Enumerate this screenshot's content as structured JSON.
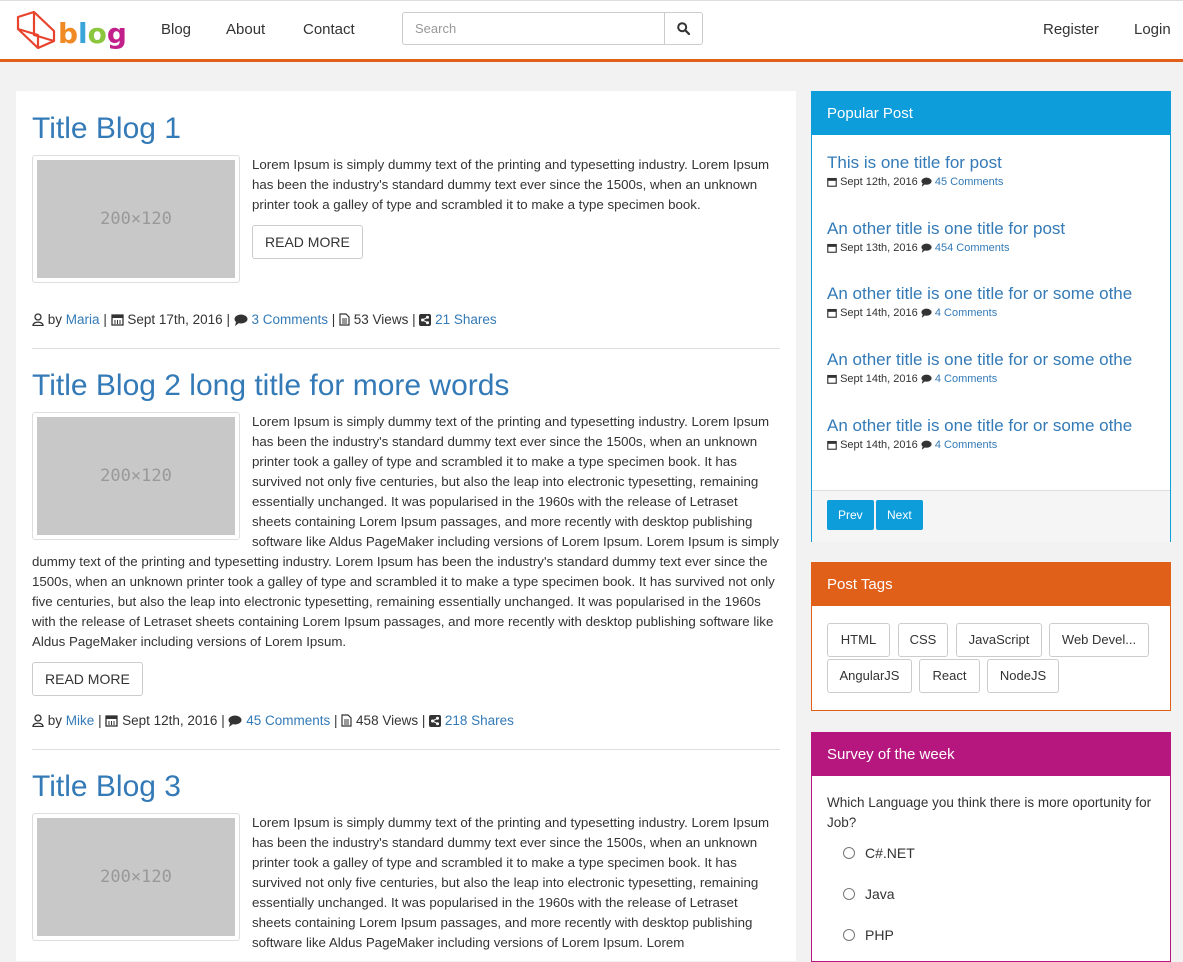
{
  "brand": {
    "logo_text": "blog",
    "colors": {
      "accent": "#e0601a",
      "link": "#337ab7",
      "popular": "#0d9ddb",
      "tags": "#e0601a",
      "survey": "#b5177f"
    }
  },
  "nav": {
    "links": [
      "Blog",
      "About",
      "Contact"
    ],
    "search_placeholder": "Search",
    "register": "Register",
    "login": "Login"
  },
  "posts": [
    {
      "title": "Title Blog 1",
      "thumb_label": "200×120",
      "body": "Lorem Ipsum is simply dummy text of the printing and typesetting industry. Lorem Ipsum has been the industry's standard dummy text ever since the 1500s, when an unknown printer took a galley of type and scrambled it to make a type specimen book.",
      "read_more": "READ MORE",
      "by": "by",
      "author": "Maria",
      "date": "Sept 17th, 2016",
      "comments": "3 Comments",
      "views": "53 Views",
      "shares": "21 Shares"
    },
    {
      "title": "Title Blog 2 long title for more words",
      "thumb_label": "200×120",
      "body": "Lorem Ipsum is simply dummy text of the printing and typesetting industry. Lorem Ipsum has been the industry's standard dummy text ever since the 1500s, when an unknown printer took a galley of type and scrambled it to make a type specimen book. It has survived not only five centuries, but also the leap into electronic typesetting, remaining essentially unchanged. It was popularised in the 1960s with the release of Letraset sheets containing Lorem Ipsum passages, and more recently with desktop publishing software like Aldus PageMaker including versions of Lorem Ipsum. Lorem Ipsum is simply dummy text of the printing and typesetting industry. Lorem Ipsum has been the industry's standard dummy text ever since the 1500s, when an unknown printer took a galley of type and scrambled it to make a type specimen book. It has survived not only five centuries, but also the leap into electronic typesetting, remaining essentially unchanged. It was popularised in the 1960s with the release of Letraset sheets containing Lorem Ipsum passages, and more recently with desktop publishing software like Aldus PageMaker including versions of Lorem Ipsum.",
      "read_more": "READ MORE",
      "by": "by",
      "author": "Mike",
      "date": "Sept 12th, 2016",
      "comments": "45 Comments",
      "views": "458 Views",
      "shares": "218 Shares"
    },
    {
      "title": "Title Blog 3",
      "thumb_label": "200×120",
      "body": "Lorem Ipsum is simply dummy text of the printing and typesetting industry. Lorem Ipsum has been the industry's standard dummy text ever since the 1500s, when an unknown printer took a galley of type and scrambled it to make a type specimen book. It has survived not only five centuries, but also the leap into electronic typesetting, remaining essentially unchanged. It was popularised in the 1960s with the release of Letraset sheets containing Lorem Ipsum passages, and more recently with desktop publishing software like Aldus PageMaker including versions of Lorem Ipsum. Lorem"
    }
  ],
  "popular": {
    "heading": "Popular Post",
    "items": [
      {
        "title": "This is one title for post",
        "date": "Sept 12th, 2016",
        "comments": "45 Comments"
      },
      {
        "title": "An other title is one title for post",
        "date": "Sept 13th, 2016",
        "comments": "454 Comments"
      },
      {
        "title": "An other title is one title for or some othe",
        "date": "Sept 14th, 2016",
        "comments": "4 Comments"
      },
      {
        "title": "An other title is one title for or some othe",
        "date": "Sept 14th, 2016",
        "comments": "4 Comments"
      },
      {
        "title": "An other title is one title for or some othe",
        "date": "Sept 14th, 2016",
        "comments": "4 Comments"
      }
    ],
    "prev": "Prev",
    "next": "Next"
  },
  "tags": {
    "heading": "Post Tags",
    "items": [
      "HTML",
      "CSS",
      "JavaScript",
      "Web Devel...",
      "AngularJS",
      "React",
      "NodeJS"
    ]
  },
  "survey": {
    "heading": "Survey of the week",
    "question": "Which Language you think there is more oportunity for Job?",
    "options": [
      "C#.NET",
      "Java",
      "PHP"
    ]
  }
}
